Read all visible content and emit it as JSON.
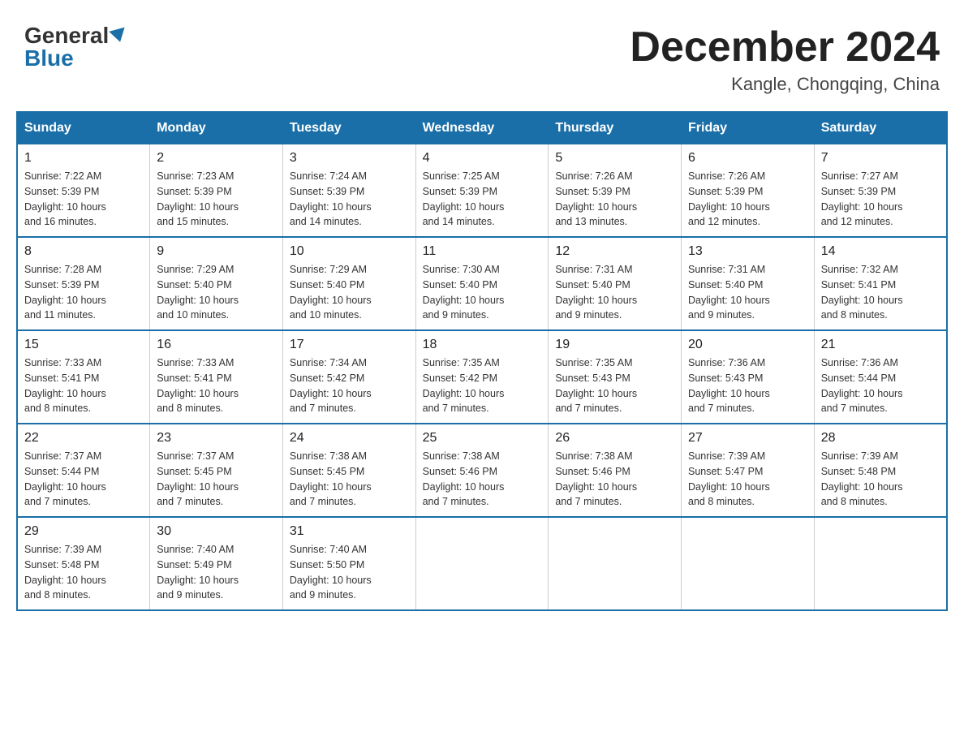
{
  "header": {
    "logo_general": "General",
    "logo_blue": "Blue",
    "month_title": "December 2024",
    "location": "Kangle, Chongqing, China"
  },
  "days_of_week": [
    "Sunday",
    "Monday",
    "Tuesday",
    "Wednesday",
    "Thursday",
    "Friday",
    "Saturday"
  ],
  "weeks": [
    [
      {
        "day": "1",
        "sunrise": "7:22 AM",
        "sunset": "5:39 PM",
        "daylight": "10 hours and 16 minutes."
      },
      {
        "day": "2",
        "sunrise": "7:23 AM",
        "sunset": "5:39 PM",
        "daylight": "10 hours and 15 minutes."
      },
      {
        "day": "3",
        "sunrise": "7:24 AM",
        "sunset": "5:39 PM",
        "daylight": "10 hours and 14 minutes."
      },
      {
        "day": "4",
        "sunrise": "7:25 AM",
        "sunset": "5:39 PM",
        "daylight": "10 hours and 14 minutes."
      },
      {
        "day": "5",
        "sunrise": "7:26 AM",
        "sunset": "5:39 PM",
        "daylight": "10 hours and 13 minutes."
      },
      {
        "day": "6",
        "sunrise": "7:26 AM",
        "sunset": "5:39 PM",
        "daylight": "10 hours and 12 minutes."
      },
      {
        "day": "7",
        "sunrise": "7:27 AM",
        "sunset": "5:39 PM",
        "daylight": "10 hours and 12 minutes."
      }
    ],
    [
      {
        "day": "8",
        "sunrise": "7:28 AM",
        "sunset": "5:39 PM",
        "daylight": "10 hours and 11 minutes."
      },
      {
        "day": "9",
        "sunrise": "7:29 AM",
        "sunset": "5:40 PM",
        "daylight": "10 hours and 10 minutes."
      },
      {
        "day": "10",
        "sunrise": "7:29 AM",
        "sunset": "5:40 PM",
        "daylight": "10 hours and 10 minutes."
      },
      {
        "day": "11",
        "sunrise": "7:30 AM",
        "sunset": "5:40 PM",
        "daylight": "10 hours and 9 minutes."
      },
      {
        "day": "12",
        "sunrise": "7:31 AM",
        "sunset": "5:40 PM",
        "daylight": "10 hours and 9 minutes."
      },
      {
        "day": "13",
        "sunrise": "7:31 AM",
        "sunset": "5:40 PM",
        "daylight": "10 hours and 9 minutes."
      },
      {
        "day": "14",
        "sunrise": "7:32 AM",
        "sunset": "5:41 PM",
        "daylight": "10 hours and 8 minutes."
      }
    ],
    [
      {
        "day": "15",
        "sunrise": "7:33 AM",
        "sunset": "5:41 PM",
        "daylight": "10 hours and 8 minutes."
      },
      {
        "day": "16",
        "sunrise": "7:33 AM",
        "sunset": "5:41 PM",
        "daylight": "10 hours and 8 minutes."
      },
      {
        "day": "17",
        "sunrise": "7:34 AM",
        "sunset": "5:42 PM",
        "daylight": "10 hours and 7 minutes."
      },
      {
        "day": "18",
        "sunrise": "7:35 AM",
        "sunset": "5:42 PM",
        "daylight": "10 hours and 7 minutes."
      },
      {
        "day": "19",
        "sunrise": "7:35 AM",
        "sunset": "5:43 PM",
        "daylight": "10 hours and 7 minutes."
      },
      {
        "day": "20",
        "sunrise": "7:36 AM",
        "sunset": "5:43 PM",
        "daylight": "10 hours and 7 minutes."
      },
      {
        "day": "21",
        "sunrise": "7:36 AM",
        "sunset": "5:44 PM",
        "daylight": "10 hours and 7 minutes."
      }
    ],
    [
      {
        "day": "22",
        "sunrise": "7:37 AM",
        "sunset": "5:44 PM",
        "daylight": "10 hours and 7 minutes."
      },
      {
        "day": "23",
        "sunrise": "7:37 AM",
        "sunset": "5:45 PM",
        "daylight": "10 hours and 7 minutes."
      },
      {
        "day": "24",
        "sunrise": "7:38 AM",
        "sunset": "5:45 PM",
        "daylight": "10 hours and 7 minutes."
      },
      {
        "day": "25",
        "sunrise": "7:38 AM",
        "sunset": "5:46 PM",
        "daylight": "10 hours and 7 minutes."
      },
      {
        "day": "26",
        "sunrise": "7:38 AM",
        "sunset": "5:46 PM",
        "daylight": "10 hours and 7 minutes."
      },
      {
        "day": "27",
        "sunrise": "7:39 AM",
        "sunset": "5:47 PM",
        "daylight": "10 hours and 8 minutes."
      },
      {
        "day": "28",
        "sunrise": "7:39 AM",
        "sunset": "5:48 PM",
        "daylight": "10 hours and 8 minutes."
      }
    ],
    [
      {
        "day": "29",
        "sunrise": "7:39 AM",
        "sunset": "5:48 PM",
        "daylight": "10 hours and 8 minutes."
      },
      {
        "day": "30",
        "sunrise": "7:40 AM",
        "sunset": "5:49 PM",
        "daylight": "10 hours and 9 minutes."
      },
      {
        "day": "31",
        "sunrise": "7:40 AM",
        "sunset": "5:50 PM",
        "daylight": "10 hours and 9 minutes."
      },
      null,
      null,
      null,
      null
    ]
  ],
  "labels": {
    "sunrise": "Sunrise:",
    "sunset": "Sunset:",
    "daylight": "Daylight:"
  }
}
